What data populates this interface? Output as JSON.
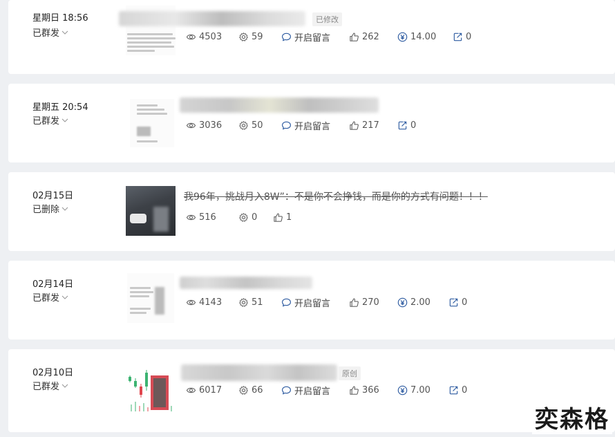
{
  "posts": [
    {
      "date": "星期日 18:56",
      "status": "已群发",
      "tag": "已修改",
      "stats": {
        "views": "4503",
        "shares": "59",
        "comment": "开启留言",
        "likes": "262",
        "reward": "14.00",
        "forwards": "0"
      }
    },
    {
      "date": "星期五 20:54",
      "status": "已群发",
      "stats": {
        "views": "3036",
        "shares": "50",
        "comment": "开启留言",
        "likes": "217",
        "forwards": "0"
      }
    },
    {
      "date": "02月15日",
      "status": "已删除",
      "title": "我96年，挑战月入8W”：不是你不会挣钱，而是你的方式有问题！！！",
      "stats": {
        "views": "516",
        "shares": "0",
        "likes": "1"
      }
    },
    {
      "date": "02月14日",
      "status": "已群发",
      "stats": {
        "views": "4143",
        "shares": "51",
        "comment": "开启留言",
        "likes": "270",
        "reward": "2.00",
        "forwards": "0"
      }
    },
    {
      "date": "02月10日",
      "status": "已群发",
      "tag": "原创",
      "stats": {
        "views": "6017",
        "shares": "66",
        "comment": "开启留言",
        "likes": "366",
        "reward": "7.00",
        "forwards": "0"
      }
    }
  ],
  "watermark": "奕森格",
  "colors": {
    "page_bg": "#eef0f3",
    "card_bg": "#ffffff",
    "text": "#333333",
    "muted": "#555555",
    "chart_green": "#3cb371",
    "chart_red": "#e0454d"
  }
}
